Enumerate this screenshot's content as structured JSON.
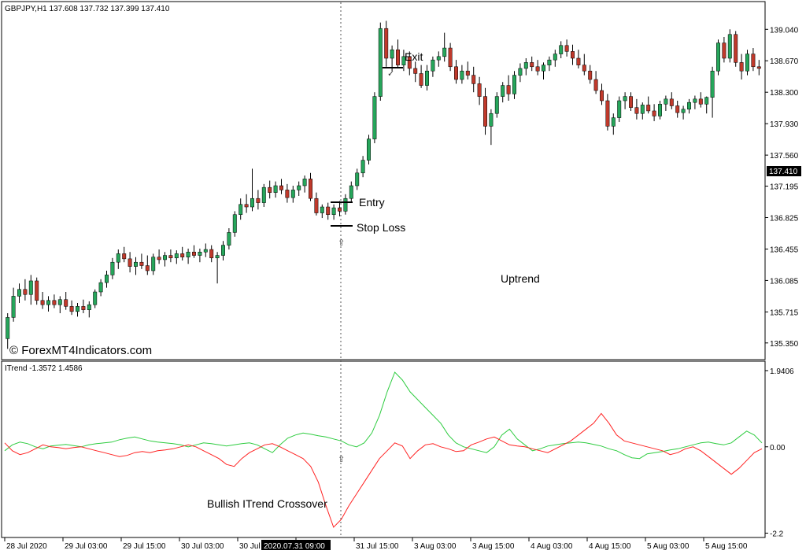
{
  "header": {
    "symbol_line": "GBPJPY,H1  137.608 137.732 137.399 137.410",
    "indicator_line": "ITrend -1.3572 1.4586"
  },
  "watermark": "© ForexMT4Indicators.com",
  "colors": {
    "bull": "#26a65b",
    "bear": "#c0392b",
    "itrend_green": "#2ecc40",
    "itrend_red": "#ff2222",
    "grid_border": "#000000",
    "price_label_bg": "#000000",
    "price_label_fg": "#ffffff"
  },
  "annotations": {
    "entry": "Entry",
    "stop_loss": "Stop Loss",
    "exit": "Exit",
    "uptrend": "Uptrend",
    "crossover": "Bullish ITrend Crossover"
  },
  "chart_data": [
    {
      "type": "candlestick",
      "title": "GBPJPY,H1",
      "ohlc_last": {
        "open": 137.608,
        "high": 137.732,
        "low": 137.399,
        "close": 137.41
      },
      "current_price_label": "137.410",
      "ylim": [
        135.2,
        139.2
      ],
      "y_ticks": [
        "139.040",
        "138.670",
        "138.300",
        "137.930",
        "137.560",
        "137.195",
        "136.825",
        "136.455",
        "136.085",
        "135.715",
        "135.350"
      ],
      "x_ticks": [
        "28 Jul 2020",
        "29 Jul 03:00",
        "29 Jul 15:00",
        "30 Jul 03:00",
        "30 Jul 15:00",
        "2020.07.31 09:00",
        "31 Jul 15:00",
        "3 Aug 03:00",
        "3 Aug 15:00",
        "4 Aug 03:00",
        "4 Aug 15:00",
        "5 Aug 03:00",
        "5 Aug 15:00"
      ],
      "highlighted_x_tick": "2020.07.31 09:00",
      "candles": [
        [
          135.4,
          135.7,
          135.28,
          135.65
        ],
        [
          135.65,
          136.0,
          135.6,
          135.9
        ],
        [
          135.9,
          136.05,
          135.82,
          135.98
        ],
        [
          135.98,
          136.1,
          135.85,
          135.92
        ],
        [
          135.92,
          136.15,
          135.8,
          136.08
        ],
        [
          136.08,
          136.12,
          135.8,
          135.85
        ],
        [
          135.85,
          135.95,
          135.75,
          135.8
        ],
        [
          135.8,
          135.9,
          135.72,
          135.85
        ],
        [
          135.85,
          135.92,
          135.76,
          135.8
        ],
        [
          135.8,
          135.9,
          135.7,
          135.86
        ],
        [
          135.86,
          135.95,
          135.74,
          135.78
        ],
        [
          135.78,
          135.85,
          135.68,
          135.72
        ],
        [
          135.72,
          135.82,
          135.66,
          135.78
        ],
        [
          135.78,
          135.86,
          135.7,
          135.74
        ],
        [
          135.74,
          135.84,
          135.65,
          135.8
        ],
        [
          135.8,
          135.98,
          135.76,
          135.95
        ],
        [
          135.95,
          136.1,
          135.9,
          136.06
        ],
        [
          136.06,
          136.2,
          136.0,
          136.15
        ],
        [
          136.15,
          136.35,
          136.1,
          136.3
        ],
        [
          136.3,
          136.45,
          136.22,
          136.4
        ],
        [
          136.4,
          136.48,
          136.3,
          136.34
        ],
        [
          136.34,
          136.42,
          136.18,
          136.25
        ],
        [
          136.25,
          136.36,
          136.15,
          136.3
        ],
        [
          136.3,
          136.4,
          136.22,
          136.26
        ],
        [
          136.26,
          136.38,
          136.15,
          136.2
        ],
        [
          136.2,
          136.4,
          136.15,
          136.36
        ],
        [
          136.36,
          136.45,
          136.28,
          136.33
        ],
        [
          136.33,
          136.42,
          136.25,
          136.38
        ],
        [
          136.38,
          136.45,
          136.3,
          136.35
        ],
        [
          136.35,
          136.44,
          136.28,
          136.4
        ],
        [
          136.4,
          136.48,
          136.32,
          136.36
        ],
        [
          136.36,
          136.46,
          136.28,
          136.42
        ],
        [
          136.42,
          136.5,
          136.35,
          136.38
        ],
        [
          136.38,
          136.46,
          136.3,
          136.42
        ],
        [
          136.42,
          136.52,
          136.36,
          136.45
        ],
        [
          136.45,
          136.5,
          136.3,
          136.35
        ],
        [
          136.35,
          136.42,
          136.05,
          136.38
        ],
        [
          136.38,
          136.55,
          136.32,
          136.5
        ],
        [
          136.5,
          136.7,
          136.45,
          136.65
        ],
        [
          136.65,
          136.9,
          136.6,
          136.86
        ],
        [
          136.86,
          137.05,
          136.8,
          136.98
        ],
        [
          136.98,
          137.1,
          136.88,
          136.95
        ],
        [
          136.95,
          137.4,
          136.9,
          137.05
        ],
        [
          137.05,
          137.15,
          136.92,
          137.0
        ],
        [
          137.0,
          137.22,
          136.95,
          137.18
        ],
        [
          137.18,
          137.26,
          137.05,
          137.12
        ],
        [
          137.12,
          137.25,
          137.06,
          137.2
        ],
        [
          137.2,
          137.28,
          137.1,
          137.15
        ],
        [
          137.15,
          137.22,
          137.0,
          137.06
        ],
        [
          137.06,
          137.2,
          137.0,
          137.15
        ],
        [
          137.15,
          137.25,
          137.08,
          137.2
        ],
        [
          137.2,
          137.32,
          137.12,
          137.28
        ],
        [
          137.28,
          137.35,
          137.02,
          137.05
        ],
        [
          137.05,
          137.12,
          136.85,
          136.88
        ],
        [
          136.88,
          136.98,
          136.82,
          136.95
        ],
        [
          136.95,
          137.0,
          136.8,
          136.86
        ],
        [
          136.86,
          136.98,
          136.8,
          136.94
        ],
        [
          136.94,
          137.02,
          136.84,
          136.9
        ],
        [
          136.9,
          137.1,
          136.86,
          137.05
        ],
        [
          137.05,
          137.25,
          137.0,
          137.2
        ],
        [
          137.2,
          137.4,
          137.15,
          137.35
        ],
        [
          137.35,
          137.55,
          137.3,
          137.5
        ],
        [
          137.5,
          137.8,
          137.45,
          137.75
        ],
        [
          137.75,
          138.3,
          137.7,
          138.25
        ],
        [
          138.25,
          139.12,
          138.2,
          139.05
        ],
        [
          139.05,
          139.14,
          138.6,
          138.7
        ],
        [
          138.7,
          138.85,
          138.55,
          138.8
        ],
        [
          138.8,
          138.92,
          138.58,
          138.62
        ],
        [
          138.62,
          138.8,
          138.55,
          138.72
        ],
        [
          138.72,
          138.78,
          138.5,
          138.58
        ],
        [
          138.58,
          138.66,
          138.42,
          138.52
        ],
        [
          138.52,
          138.62,
          138.35,
          138.38
        ],
        [
          138.38,
          138.62,
          138.32,
          138.55
        ],
        [
          138.55,
          138.72,
          138.48,
          138.68
        ],
        [
          138.68,
          138.78,
          138.6,
          138.72
        ],
        [
          138.72,
          139.0,
          138.66,
          138.82
        ],
        [
          138.82,
          138.88,
          138.55,
          138.6
        ],
        [
          138.6,
          138.68,
          138.4,
          138.45
        ],
        [
          138.45,
          138.62,
          138.4,
          138.55
        ],
        [
          138.55,
          138.66,
          138.45,
          138.5
        ],
        [
          138.5,
          138.6,
          138.3,
          138.4
        ],
        [
          138.4,
          138.48,
          138.15,
          138.25
        ],
        [
          138.25,
          138.35,
          137.8,
          137.9
        ],
        [
          137.9,
          138.1,
          137.68,
          138.05
        ],
        [
          138.05,
          138.3,
          138.0,
          138.25
        ],
        [
          138.25,
          138.42,
          138.18,
          138.38
        ],
        [
          138.38,
          138.5,
          138.2,
          138.28
        ],
        [
          138.28,
          138.55,
          138.22,
          138.5
        ],
        [
          138.5,
          138.64,
          138.42,
          138.58
        ],
        [
          138.58,
          138.7,
          138.5,
          138.65
        ],
        [
          138.65,
          138.72,
          138.55,
          138.6
        ],
        [
          138.6,
          138.68,
          138.5,
          138.55
        ],
        [
          138.55,
          138.65,
          138.45,
          138.62
        ],
        [
          138.62,
          138.72,
          138.55,
          138.68
        ],
        [
          138.68,
          138.8,
          138.6,
          138.75
        ],
        [
          138.75,
          138.9,
          138.7,
          138.85
        ],
        [
          138.85,
          138.92,
          138.72,
          138.78
        ],
        [
          138.78,
          138.86,
          138.62,
          138.7
        ],
        [
          138.7,
          138.8,
          138.58,
          138.62
        ],
        [
          138.62,
          138.75,
          138.5,
          138.55
        ],
        [
          138.55,
          138.62,
          138.4,
          138.45
        ],
        [
          138.45,
          138.55,
          138.28,
          138.32
        ],
        [
          138.32,
          138.4,
          138.15,
          138.2
        ],
        [
          138.2,
          138.28,
          137.85,
          137.9
        ],
        [
          137.9,
          138.05,
          137.8,
          138.0
        ],
        [
          138.0,
          138.25,
          137.95,
          138.2
        ],
        [
          138.2,
          138.3,
          138.1,
          138.25
        ],
        [
          138.25,
          138.3,
          138.08,
          138.12
        ],
        [
          138.12,
          138.22,
          137.98,
          138.05
        ],
        [
          138.05,
          138.18,
          137.98,
          138.15
        ],
        [
          138.15,
          138.25,
          138.05,
          138.08
        ],
        [
          138.08,
          138.16,
          137.96,
          138.02
        ],
        [
          138.02,
          138.2,
          137.98,
          138.16
        ],
        [
          138.16,
          138.26,
          138.08,
          138.22
        ],
        [
          138.22,
          138.3,
          138.1,
          138.14
        ],
        [
          138.14,
          138.2,
          138.0,
          138.06
        ],
        [
          138.06,
          138.14,
          137.98,
          138.1
        ],
        [
          138.1,
          138.22,
          138.05,
          138.18
        ],
        [
          138.18,
          138.26,
          138.1,
          138.22
        ],
        [
          138.22,
          138.3,
          138.12,
          138.16
        ],
        [
          138.16,
          138.25,
          138.05,
          138.24
        ],
        [
          138.24,
          138.6,
          138.0,
          138.55
        ],
        [
          138.55,
          138.92,
          138.5,
          138.88
        ],
        [
          138.88,
          138.95,
          138.65,
          138.7
        ],
        [
          138.7,
          139.04,
          138.65,
          138.98
        ],
        [
          138.98,
          139.02,
          138.6,
          138.65
        ],
        [
          138.65,
          138.75,
          138.45,
          138.55
        ],
        [
          138.55,
          138.8,
          138.5,
          138.75
        ],
        [
          138.75,
          138.82,
          138.55,
          138.6
        ],
        [
          138.6,
          138.68,
          138.5,
          138.58
        ]
      ],
      "trade_levels": {
        "entry": 137.05,
        "stop_loss": 136.78,
        "exit": 138.6
      }
    },
    {
      "type": "line",
      "title": "ITrend",
      "values_label": "-1.3572 1.4586",
      "ylim": [
        -2.25,
        2.0
      ],
      "y_ticks": [
        "1.9406",
        "0.00",
        "-2.2"
      ],
      "series": [
        {
          "color": "green",
          "values": [
            -0.1,
            0.05,
            0.12,
            0.08,
            0.0,
            -0.05,
            0.02,
            0.04,
            0.06,
            0.03,
            0.0,
            0.05,
            0.08,
            0.1,
            0.12,
            0.18,
            0.22,
            0.25,
            0.2,
            0.15,
            0.12,
            0.1,
            0.08,
            0.05,
            0.0,
            0.05,
            0.1,
            0.08,
            0.05,
            0.02,
            0.05,
            0.08,
            0.1,
            0.05,
            -0.05,
            -0.15,
            0.05,
            0.22,
            0.3,
            0.35,
            0.32,
            0.28,
            0.25,
            0.2,
            0.15,
            0.05,
            0.0,
            0.1,
            0.35,
            0.8,
            1.4,
            1.9,
            1.7,
            1.4,
            1.2,
            1.0,
            0.8,
            0.6,
            0.3,
            0.1,
            0.0,
            -0.05,
            -0.1,
            -0.15,
            0.0,
            0.3,
            0.45,
            0.2,
            0.05,
            -0.1,
            -0.05,
            0.02,
            0.05,
            0.08,
            0.1,
            0.12,
            0.1,
            0.06,
            0.02,
            -0.05,
            -0.1,
            -0.2,
            -0.28,
            -0.3,
            -0.18,
            -0.15,
            -0.12,
            -0.08,
            -0.05,
            0.0,
            0.05,
            0.1,
            0.12,
            0.08,
            0.05,
            0.1,
            0.25,
            0.4,
            0.3,
            0.1
          ]
        },
        {
          "color": "red",
          "values": [
            0.1,
            -0.1,
            -0.2,
            -0.15,
            -0.05,
            0.05,
            0.0,
            -0.02,
            -0.05,
            -0.02,
            0.0,
            -0.05,
            -0.1,
            -0.15,
            -0.2,
            -0.25,
            -0.22,
            -0.15,
            -0.12,
            -0.15,
            -0.1,
            -0.08,
            -0.05,
            0.0,
            0.05,
            0.0,
            -0.1,
            -0.2,
            -0.3,
            -0.45,
            -0.5,
            -0.3,
            -0.15,
            -0.05,
            0.05,
            0.08,
            0.0,
            -0.1,
            -0.2,
            -0.3,
            -0.5,
            -0.9,
            -1.5,
            -2.05,
            -1.85,
            -1.5,
            -1.2,
            -0.9,
            -0.6,
            -0.3,
            -0.1,
            0.1,
            0.02,
            -0.3,
            -0.1,
            0.05,
            0.08,
            0.0,
            -0.05,
            -0.12,
            -0.1,
            0.05,
            0.12,
            0.2,
            0.25,
            0.15,
            0.05,
            0.02,
            0.0,
            -0.05,
            -0.1,
            -0.15,
            -0.05,
            0.05,
            0.15,
            0.3,
            0.45,
            0.6,
            0.85,
            0.6,
            0.3,
            0.15,
            0.1,
            0.05,
            0.0,
            -0.05,
            -0.1,
            -0.2,
            -0.15,
            -0.05,
            0.0,
            -0.1,
            -0.25,
            -0.4,
            -0.55,
            -0.7,
            -0.55,
            -0.35,
            -0.15,
            -0.05
          ]
        }
      ]
    }
  ]
}
